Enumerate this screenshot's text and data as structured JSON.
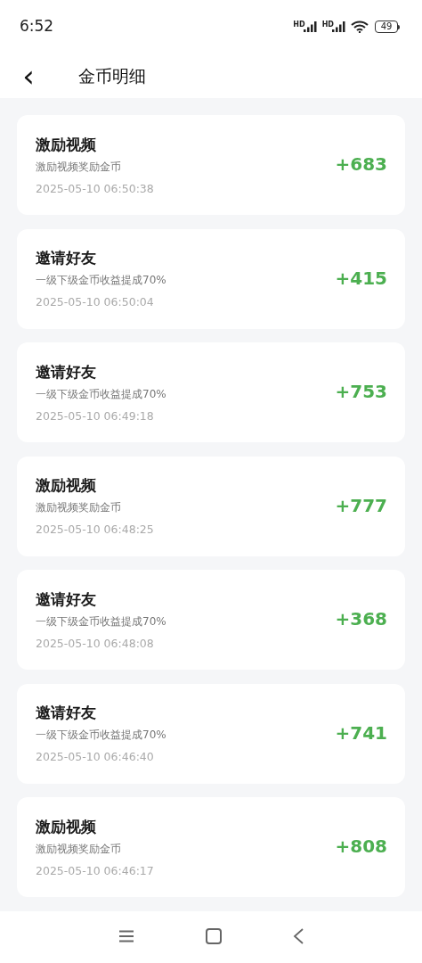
{
  "status_bar": {
    "time": "6:52",
    "signal_labels": [
      "HD",
      "HD"
    ],
    "battery": "49"
  },
  "header": {
    "back": "‹",
    "title": "金币明细"
  },
  "records": [
    {
      "title": "激励视频",
      "description": "激励视频奖励金币",
      "time": "2025-05-10 06:50:38",
      "amount": "+683"
    },
    {
      "title": "邀请好友",
      "description": "一级下级金币收益提成70%",
      "time": "2025-05-10 06:50:04",
      "amount": "+415"
    },
    {
      "title": "邀请好友",
      "description": "一级下级金币收益提成70%",
      "time": "2025-05-10 06:49:18",
      "amount": "+753"
    },
    {
      "title": "激励视频",
      "description": "激励视频奖励金币",
      "time": "2025-05-10 06:48:25",
      "amount": "+777"
    },
    {
      "title": "邀请好友",
      "description": "一级下级金币收益提成70%",
      "time": "2025-05-10 06:48:08",
      "amount": "+368"
    },
    {
      "title": "邀请好友",
      "description": "一级下级金币收益提成70%",
      "time": "2025-05-10 06:46:40",
      "amount": "+741"
    },
    {
      "title": "激励视频",
      "description": "激励视频奖励金币",
      "time": "2025-05-10 06:46:17",
      "amount": "+808"
    }
  ]
}
